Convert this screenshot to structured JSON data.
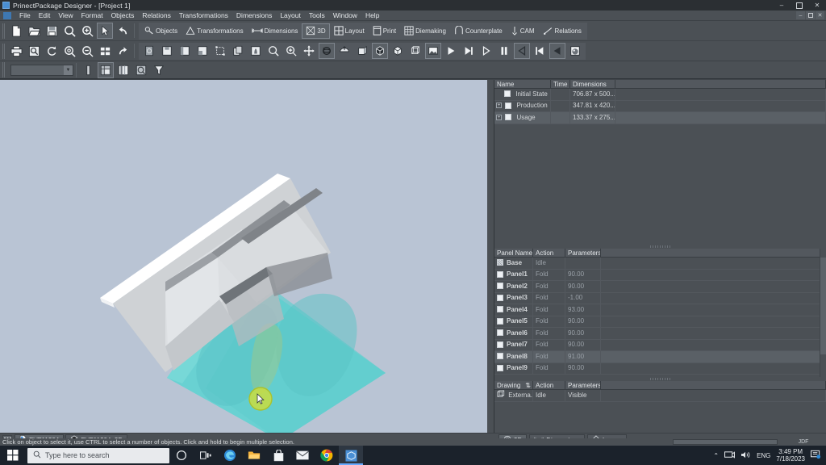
{
  "window": {
    "title": "PrinectPackage Designer - [Project 1]",
    "app_icon": "package-designer-icon",
    "controls": {
      "minimize": "–",
      "maximize": "❐",
      "close": "✕"
    },
    "mdi_controls": {
      "minimize": "–",
      "restore": "❐",
      "close": "✕"
    }
  },
  "menubar": {
    "items": [
      {
        "label": "File"
      },
      {
        "label": "Edit"
      },
      {
        "label": "View"
      },
      {
        "label": "Format"
      },
      {
        "label": "Objects"
      },
      {
        "label": "Relations"
      },
      {
        "label": "Transformations"
      },
      {
        "label": "Dimensions"
      },
      {
        "label": "Layout"
      },
      {
        "label": "Tools"
      },
      {
        "label": "Window"
      },
      {
        "label": "Help"
      }
    ]
  },
  "toolbar_row1": {
    "buttons": [
      {
        "name": "new-document-button",
        "icon": "page-icon"
      },
      {
        "name": "open-file-button",
        "icon": "folder-open-icon"
      },
      {
        "name": "save-button",
        "icon": "floppy-disk-icon"
      },
      {
        "name": "zoom-button",
        "icon": "magnifier-icon"
      },
      {
        "name": "zoom-in-button",
        "icon": "magnifier-plus-icon"
      },
      {
        "name": "select-arrow-button",
        "icon": "cursor-arrow-icon"
      },
      {
        "name": "undo-button",
        "icon": "undo-arrow-icon"
      }
    ]
  },
  "toolbar_row2": {
    "buttons": [
      {
        "name": "print-button",
        "icon": "printer-icon"
      },
      {
        "name": "print-preview-button",
        "icon": "print-preview-icon"
      },
      {
        "name": "refresh-button",
        "icon": "refresh-arrow-icon"
      },
      {
        "name": "zoom-fit-button",
        "icon": "zoom-fit-icon"
      },
      {
        "name": "zoom-out-button",
        "icon": "magnifier-minus-icon"
      },
      {
        "name": "grid-view-button",
        "icon": "grid-tiles-icon"
      },
      {
        "name": "redo-button",
        "icon": "redo-arrow-icon"
      }
    ]
  },
  "ribbon_tabs": [
    {
      "label": "Objects",
      "icon": "objects-icon",
      "active": false
    },
    {
      "label": "Transformations",
      "icon": "transformations-icon",
      "active": false
    },
    {
      "label": "Dimensions",
      "icon": "dimensions-icon",
      "active": false
    },
    {
      "label": "3D",
      "icon": "cube-3d-icon",
      "active": true
    },
    {
      "label": "Layout",
      "icon": "layout-grid-icon",
      "active": false
    },
    {
      "label": "Print",
      "icon": "print-sheet-icon",
      "active": false
    },
    {
      "label": "Diemaking",
      "icon": "diemaking-icon",
      "active": false
    },
    {
      "label": "Counterplate",
      "icon": "counterplate-icon",
      "active": false
    },
    {
      "label": "CAM",
      "icon": "cam-icon",
      "active": false
    },
    {
      "label": "Relations",
      "icon": "relations-icon",
      "active": false
    }
  ],
  "toolbar_3d": {
    "buttons": [
      {
        "name": "new-3d-view-button",
        "icon": "page-3d-icon"
      },
      {
        "name": "save-3d-button",
        "icon": "save-3d-icon"
      },
      {
        "name": "fold-panel-button",
        "icon": "fold-panel-icon"
      },
      {
        "name": "arrange-panels-button",
        "icon": "arrange-panels-icon"
      },
      {
        "name": "bounding-box-button",
        "icon": "bounding-box-icon"
      },
      {
        "name": "copy-panel-button",
        "icon": "copy-panel-icon"
      },
      {
        "name": "insert-object-button",
        "icon": "insert-object-icon"
      },
      {
        "name": "zoom-tool-button",
        "icon": "magnifier-icon"
      },
      {
        "name": "zoom-in-tool-button",
        "icon": "magnifier-plus-icon"
      },
      {
        "name": "pan-move-button",
        "icon": "move-cross-icon"
      },
      {
        "name": "rotate-3d-button",
        "icon": "rotate-3d-icon"
      },
      {
        "name": "flip-view-button",
        "icon": "flip-view-icon"
      },
      {
        "name": "perspective-button",
        "icon": "perspective-box-icon"
      },
      {
        "name": "solid-shading-button",
        "icon": "solid-cube-icon"
      },
      {
        "name": "shaded-view-button",
        "icon": "shaded-cube-icon"
      },
      {
        "name": "wireframe-view-button",
        "icon": "wireframe-cube-icon"
      },
      {
        "name": "texture-view-button",
        "icon": "texture-image-icon"
      },
      {
        "name": "play-animation-button",
        "icon": "play-icon"
      },
      {
        "name": "play-to-end-button",
        "icon": "play-end-icon"
      },
      {
        "name": "step-forward-button",
        "icon": "step-forward-icon"
      },
      {
        "name": "pause-animation-button",
        "icon": "pause-icon"
      },
      {
        "name": "step-back-button",
        "icon": "step-back-icon"
      },
      {
        "name": "rewind-start-button",
        "icon": "rewind-start-icon"
      },
      {
        "name": "play-reverse-button",
        "icon": "play-reverse-icon"
      },
      {
        "name": "render-preview-button",
        "icon": "render-sphere-icon"
      }
    ]
  },
  "toolbar_row3": {
    "combo_value": "",
    "combo_arrow": "▼",
    "buttons": [
      {
        "name": "layer-list-button",
        "icon": "layer-bar-icon"
      },
      {
        "name": "diemaking-layout-button",
        "icon": "die-layout-icon"
      },
      {
        "name": "panel-strip-button",
        "icon": "panel-strip-icon"
      },
      {
        "name": "preview-search-button",
        "icon": "preview-magnifier-icon"
      },
      {
        "name": "filter-button",
        "icon": "funnel-filter-icon"
      }
    ]
  },
  "structure_grid": {
    "headers": [
      "Name",
      "Time",
      "Dimensions"
    ],
    "rows": [
      {
        "name": "Initial State",
        "time": "",
        "dimensions": "706.87 x 500...",
        "expandable": false,
        "checked": false,
        "selected": false
      },
      {
        "name": "Production",
        "time": "",
        "dimensions": "347.81 x 420...",
        "expandable": true,
        "checked": false,
        "selected": false
      },
      {
        "name": "Usage",
        "time": "",
        "dimensions": "133.37 x 275...",
        "expandable": true,
        "checked": false,
        "selected": true
      }
    ]
  },
  "panel_grid": {
    "headers": [
      "Panel Name",
      "Action",
      "Parameters ..."
    ],
    "rows": [
      {
        "panel": "Base",
        "action": "Idle",
        "parameters": "",
        "hatched": true
      },
      {
        "panel": "Panel1",
        "action": "Fold",
        "parameters": "90.00",
        "hatched": false
      },
      {
        "panel": "Panel2",
        "action": "Fold",
        "parameters": "90.00",
        "hatched": false
      },
      {
        "panel": "Panel3",
        "action": "Fold",
        "parameters": "-1.00",
        "hatched": false
      },
      {
        "panel": "Panel4",
        "action": "Fold",
        "parameters": "93.00",
        "hatched": false
      },
      {
        "panel": "Panel5",
        "action": "Fold",
        "parameters": "90.00",
        "hatched": false
      },
      {
        "panel": "Panel6",
        "action": "Fold",
        "parameters": "90.00",
        "hatched": false
      },
      {
        "panel": "Panel7",
        "action": "Fold",
        "parameters": "90.00",
        "hatched": false
      },
      {
        "panel": "Panel8",
        "action": "Fold",
        "parameters": "91.00",
        "hatched": false
      },
      {
        "panel": "Panel9",
        "action": "Fold",
        "parameters": "90.00",
        "hatched": false
      }
    ]
  },
  "drawing_grid": {
    "headers": [
      "Drawing",
      "Action",
      "Parameters ..."
    ],
    "sort_glyph": "⇅",
    "rows": [
      {
        "drawing": "Externa...",
        "action": "Idle",
        "parameters": "Visible",
        "icon": "wireframe-cube-icon"
      }
    ]
  },
  "viewport": {
    "background_color": "#b9c4d4",
    "model": {
      "carton_color": "#f2f2f2",
      "carton_shade_color": "#8f8f8f",
      "blister_color": "#58d0cf",
      "cursor_highlight_color": "#c6dc3c"
    },
    "scroll_left_arrow": "◄",
    "scroll_right_arrow": "►"
  },
  "document_tabs": {
    "menu_glyph": "▪▪",
    "tabs": [
      {
        "label": "EVF11204",
        "icon": "document-page-icon",
        "active": true
      },
      {
        "label": "EVF11204_3D",
        "icon": "cube-3d-icon",
        "active": false
      }
    ]
  },
  "view_tabs": [
    {
      "label": "3D",
      "icon": "cube-3d-icon",
      "active": true
    },
    {
      "label": "Dimensions",
      "icon": "dimensions-icon",
      "active": false
    },
    {
      "label": "Layers",
      "icon": "layers-diamond-icon",
      "active": false
    }
  ],
  "status_bar": {
    "message": "Click on object to select it, use CTRL to select a number of objects. Click and hold to begin multiple selection.",
    "jdf_label": "JDF"
  },
  "taskbar": {
    "start_icon": "windows-start-icon",
    "search_placeholder": "Type here to search",
    "search_icon": "search-icon",
    "icons": [
      {
        "name": "cortana-icon"
      },
      {
        "name": "task-view-icon"
      },
      {
        "name": "microsoft-edge-icon"
      },
      {
        "name": "file-explorer-icon"
      },
      {
        "name": "microsoft-store-icon"
      },
      {
        "name": "mail-icon"
      },
      {
        "name": "google-chrome-icon"
      },
      {
        "name": "package-designer-taskbar-icon"
      }
    ],
    "tray": {
      "chevron": "⌃",
      "network_icon": "network-icon",
      "volume_icon": "volume-icon",
      "language": "ENG",
      "time": "3:49 PM",
      "date": "7/18/2023",
      "notification_icon": "notifications-icon"
    }
  }
}
